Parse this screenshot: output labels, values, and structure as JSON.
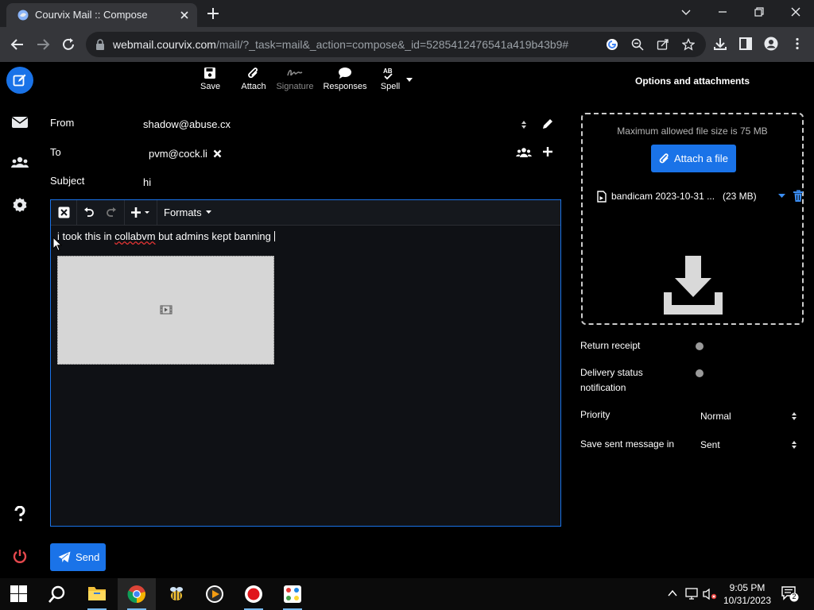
{
  "browser": {
    "tab_title": "Courvix Mail :: Compose",
    "url_host": "webmail.courvix.com",
    "url_path": "/mail/?_task=mail&_action=compose&_id=5285412476541a419b43b9#"
  },
  "compose_toolbar": {
    "save": "Save",
    "attach": "Attach",
    "signature": "Signature",
    "responses": "Responses",
    "spell": "Spell"
  },
  "options_title": "Options and attachments",
  "headers": {
    "from_label": "From",
    "from_value": "shadow@abuse.cx",
    "to_label": "To",
    "to_recipient": "pvm@cock.li",
    "subject_label": "Subject",
    "subject_value": "hi"
  },
  "editor": {
    "formats": "Formats",
    "body_before": "i took this in ",
    "body_misspelled": "collabvm",
    "body_after": " but admins kept banning"
  },
  "send_label": "Send",
  "attachments": {
    "max_size": "Maximum allowed file size is 75 MB",
    "attach_button": "Attach a file",
    "file_name": "bandicam 2023-10-31 ...",
    "file_size": "(23 MB)"
  },
  "options": {
    "return_receipt": "Return receipt",
    "delivery_status_line1": "Delivery status",
    "delivery_status_line2": "notification",
    "priority_label": "Priority",
    "priority_value": "Normal",
    "save_sent_label": "Save sent message in",
    "save_sent_value": "Sent"
  },
  "taskbar": {
    "time": "9:05 PM",
    "date": "10/31/2023",
    "notification_count": "2"
  },
  "colors": {
    "accent": "#1a73e8",
    "danger": "#e5484d",
    "background": "#000000"
  }
}
